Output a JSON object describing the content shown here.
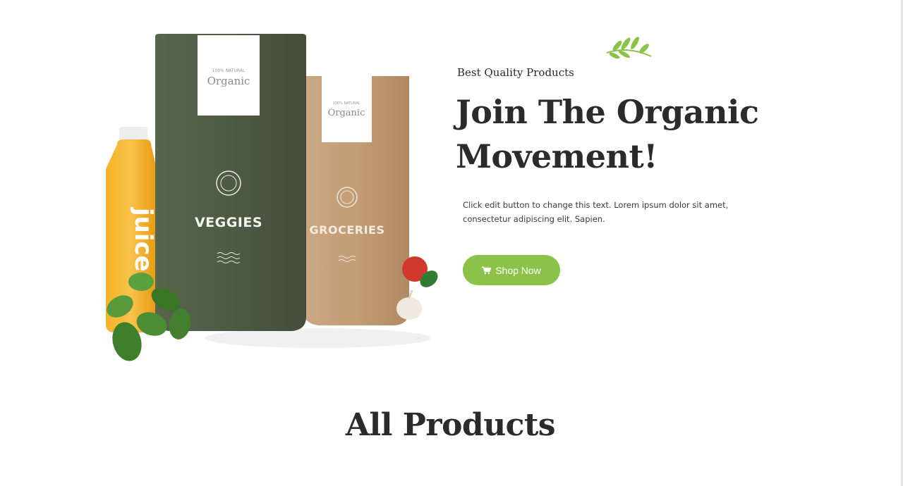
{
  "hero": {
    "eyebrow": "Best Quality Products",
    "headline": "Join The Organic Movement!",
    "description": "Click edit button to change this text. Lorem ipsum dolor sit amet, consectetur adipiscing elit. Sapien.",
    "shop_button_label": "Shop Now",
    "shop_button_icon": "cart-icon",
    "decor_icon": "leaf-sprig-icon"
  },
  "product_image": {
    "veggies_pouch": {
      "brand": "Organic",
      "badge": "100% NATURAL",
      "label": "VEGGIES"
    },
    "groceries_pouch": {
      "brand": "Organic",
      "badge": "100% NATURAL",
      "label": "GROCERIES"
    },
    "juice_bottle": {
      "label": "juice."
    }
  },
  "section": {
    "title": "All Products"
  },
  "colors": {
    "accent": "#8bc34a",
    "heading": "#2b2b2b",
    "veggies_pouch": "#4e5b44",
    "groceries_pouch": "#c4a07a",
    "juice": "#f4a81d"
  }
}
